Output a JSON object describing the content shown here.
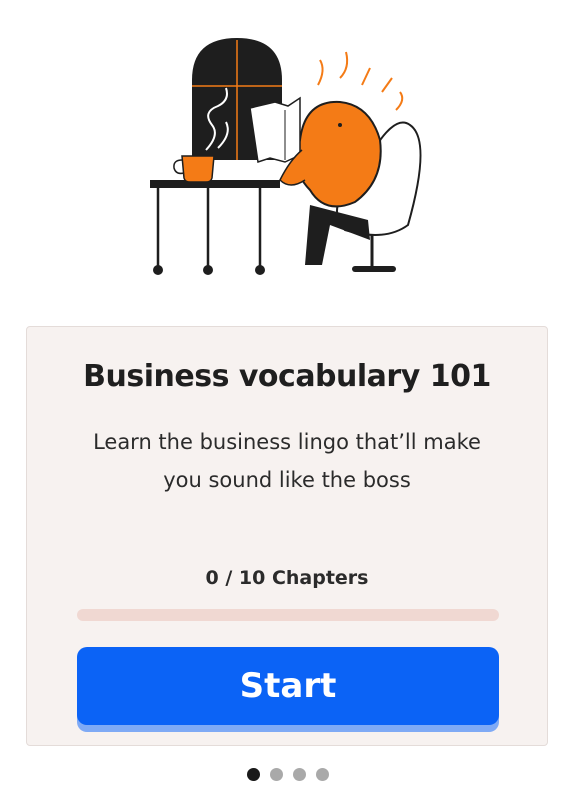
{
  "illustration": {
    "icon": "reading-blob-character-illustration",
    "accent_color": "#f47b16"
  },
  "course": {
    "title": "Business vocabulary 101",
    "subtitle": "Learn the business lingo that’ll make you sound like the boss",
    "progress_label": "0 / 10 Chapters",
    "progress_fraction": 0,
    "start_label": "Start"
  },
  "pager": {
    "count": 4,
    "active_index": 0
  },
  "colors": {
    "primary": "#0b63f6",
    "card_background": "#f7f2f0",
    "progress_track": "#f0d8d2"
  }
}
